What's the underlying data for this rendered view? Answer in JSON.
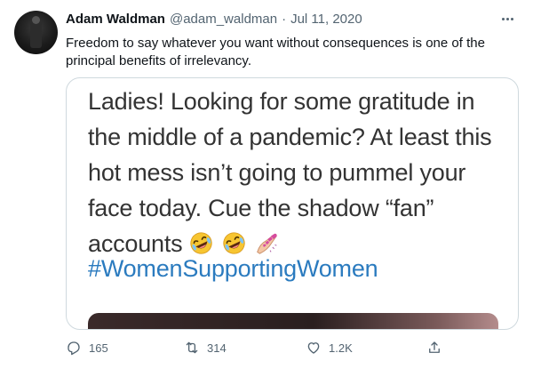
{
  "author": {
    "name": "Adam Waldman",
    "handle": "@adam_waldman",
    "separator": "·",
    "date": "Jul 11, 2020"
  },
  "tweet_text": "Freedom to say whatever you want without consequences is one of the principal benefits of irrelevancy.",
  "media": {
    "line1": "Ladies! Looking for some gratitude in",
    "line2": "the middle of a pandemic? At least this",
    "line3": "hot mess isn’t going to pummel your",
    "line4": "face today. Cue the shadow “fan”",
    "line5": "accounts",
    "hashtag": "#WomenSupportingWomen",
    "emojis": [
      "rolling-on-floor-laughing",
      "rolling-on-floor-laughing",
      "nail-polish"
    ]
  },
  "actions": {
    "reply_count": "165",
    "retweet_count": "314",
    "like_count": "1.2K"
  },
  "colors": {
    "secondary_text": "#536471",
    "border": "#cfd9de",
    "hashtag": "#2b7bbf",
    "media_text": "#333333"
  }
}
